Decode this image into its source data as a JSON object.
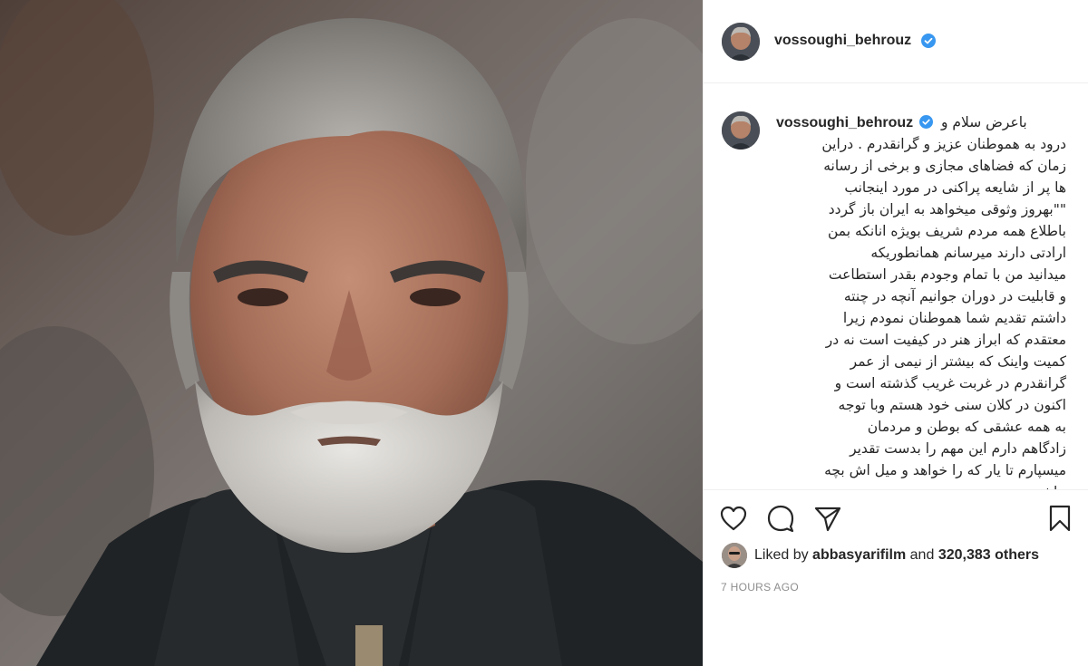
{
  "post": {
    "username": "vossoughi_behrouz",
    "verified": true,
    "time_ago": "7 HOURS AGO"
  },
  "caption": {
    "username": "vossoughi_behrouz",
    "first_line": "باعرض سلام و",
    "lines": [
      "درود به هموطنان عزیز و گرانقدرم . دراین",
      "زمان که فضاهای مجازی و برخی از رسانه",
      "ها پر از شایعه پراکنی در مورد اینجانب",
      "\"\"بهروز وثوقی میخواهد به ایران باز گردد",
      "باطلاع همه مردم شریف بویژه انانکه بمن",
      "ارادتی دارند میرسانم همانطوریکه",
      "میدانید من با تمام وجودم بقدر استطاعت",
      "و قابلیت در دوران جوانیم آنچه در چنته",
      "داشتم تقدیم شما هموطنان نمودم زیرا",
      "معتقدم که ابراز هنر در کیفیت است نه در",
      "کمیت واینک که بیشتر از نیمی از عمر",
      "گرانقدرم در غربت غریب گذشته است و",
      "اکنون در کلان سنی خود هستم وبا توجه",
      "به همه عشقی که بوطن و مردمان",
      "زادگاهم دارم این مهم را بدست تقدیر",
      "میسپارم تا یار که را خواهد و میل اش بچه",
      ".باشد"
    ]
  },
  "likes": {
    "prefix": "Liked by",
    "liker": "abbasyarifilm",
    "and": "and",
    "others": "320,383 others"
  },
  "icons": {
    "like": "heart-icon",
    "comment": "comment-icon",
    "share": "share-icon",
    "save": "bookmark-icon",
    "verified": "verified-badge-icon"
  },
  "colors": {
    "verified_blue": "#3897f0",
    "text": "#262626",
    "muted": "#8e8e8e"
  }
}
